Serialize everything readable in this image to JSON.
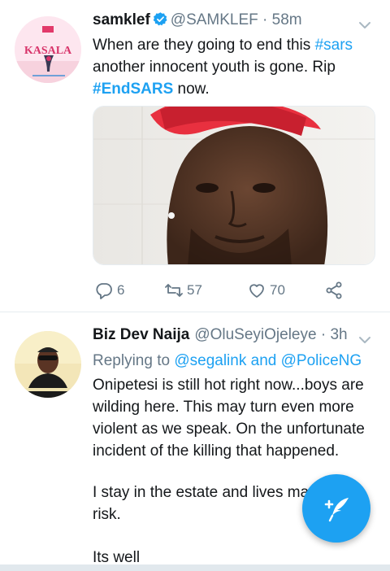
{
  "tweets": [
    {
      "name": "samklef",
      "verified": true,
      "handle": "@SAMKLEF",
      "separator": " · ",
      "time": "58m",
      "avatar_text": "KASALA",
      "text_parts": [
        "When are they going to end this ",
        "#sars",
        " another innocent youth is gone.  Rip ",
        "#EndSARS",
        "  now."
      ],
      "actions": {
        "replies": "6",
        "retweets": "57",
        "likes": "70"
      }
    },
    {
      "name": "Biz Dev Naija",
      "handle": "@OluSeyiOjeleye",
      "separator": " · ",
      "time": "3h",
      "replying_label": "Replying to ",
      "mention_1": "@segalink",
      "and_label": " and ",
      "mention_2": "@PoliceNG",
      "paragraphs": [
        "Onipetesi is still hot right now...boys are wilding here. This may turn even more violent as we speak. On the unfortunate incident of the killing that happened.",
        "I stay in the estate and lives ma",
        "risk.",
        "Its well"
      ]
    }
  ],
  "colors": {
    "accent": "#1da1f2",
    "muted": "#657786",
    "text": "#14171a"
  },
  "icons": {
    "reply": "reply-icon",
    "retweet": "retweet-icon",
    "like": "heart-icon",
    "share": "share-icon",
    "compose": "compose-icon",
    "verified": "verified-badge-icon",
    "caret": "chevron-down-icon"
  }
}
